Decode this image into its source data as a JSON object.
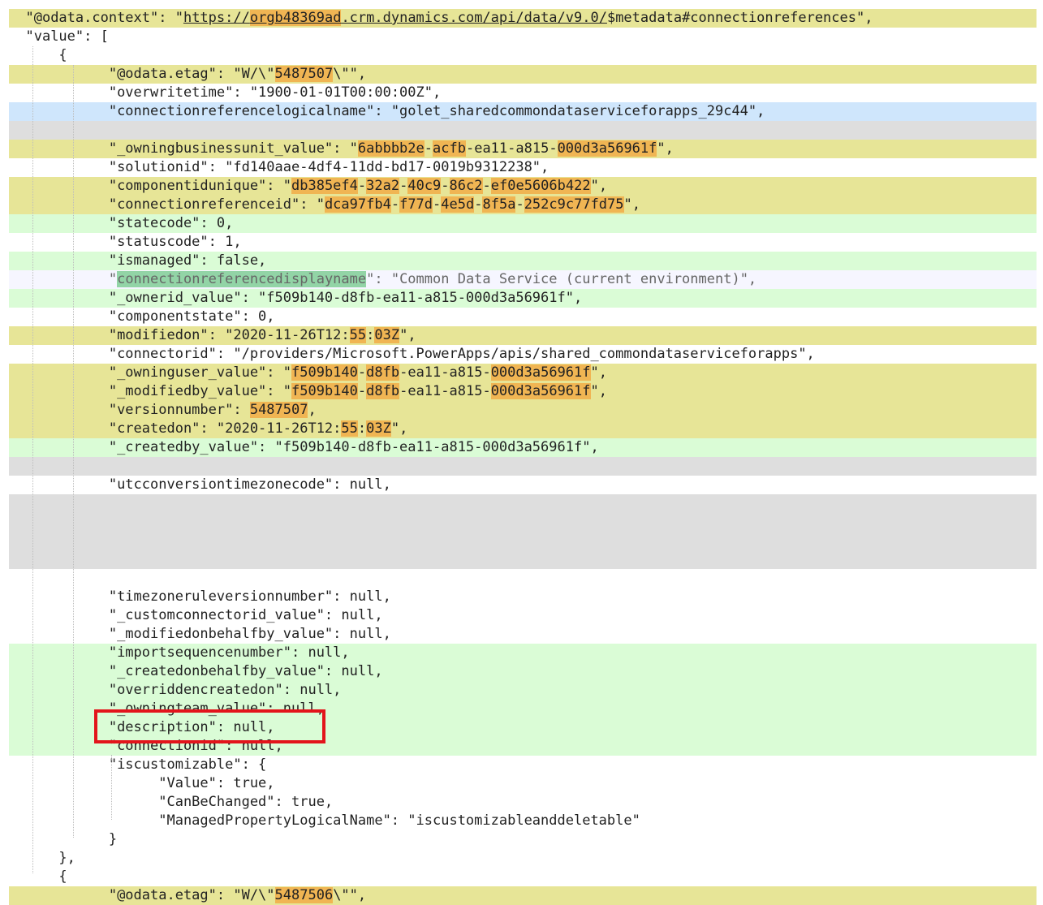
{
  "json_view": {
    "lines": [
      {
        "indent": "  ",
        "bg": "yellow",
        "segments": [
          {
            "t": "\"@odata.context\": \""
          },
          {
            "t": "https://",
            "c": "lnk"
          },
          {
            "t": "orgb48369ad",
            "c": "hl lnk"
          },
          {
            "t": ".crm.dynamics.com/api/data/v9.0/",
            "c": "lnk"
          },
          {
            "t": "$metadata#connectionreferences\","
          }
        ]
      },
      {
        "indent": "  ",
        "bg": "white",
        "segments": [
          {
            "t": "\"value\": ["
          }
        ]
      },
      {
        "indent": "      ",
        "bg": "white",
        "segments": [
          {
            "t": "{"
          }
        ]
      },
      {
        "indent": "            ",
        "bg": "yellow",
        "segments": [
          {
            "t": "\"@odata.etag\": \"W/\\\""
          },
          {
            "t": "5487507",
            "c": "hl"
          },
          {
            "t": "\\\"\","
          }
        ]
      },
      {
        "indent": "            ",
        "bg": "white",
        "segments": [
          {
            "t": "\"overwritetime\": \"1900-01-01T00:00:00Z\","
          }
        ]
      },
      {
        "indent": "            ",
        "bg": "blue",
        "segments": [
          {
            "t": "\"connectionreferencelogicalname\": \"golet_sharedcommondataserviceforapps_29c44\","
          }
        ]
      },
      {
        "indent": "",
        "bg": "gray",
        "segments": [
          {
            "t": ""
          }
        ]
      },
      {
        "indent": "            ",
        "bg": "yellow",
        "segments": [
          {
            "t": "\"_owningbusinessunit_value\": \""
          },
          {
            "t": "6abbbb2e",
            "c": "hl"
          },
          {
            "t": "-"
          },
          {
            "t": "acfb",
            "c": "hl"
          },
          {
            "t": "-ea11-a815-"
          },
          {
            "t": "000d3a56961f",
            "c": "hl"
          },
          {
            "t": "\","
          }
        ]
      },
      {
        "indent": "            ",
        "bg": "white",
        "segments": [
          {
            "t": "\"solutionid\": \"fd140aae-4df4-11dd-bd17-0019b9312238\","
          }
        ]
      },
      {
        "indent": "            ",
        "bg": "yellow",
        "segments": [
          {
            "t": "\"componentidunique\": \""
          },
          {
            "t": "db385ef4",
            "c": "hl"
          },
          {
            "t": "-"
          },
          {
            "t": "32a2",
            "c": "hl"
          },
          {
            "t": "-"
          },
          {
            "t": "40c9",
            "c": "hl"
          },
          {
            "t": "-"
          },
          {
            "t": "86c2",
            "c": "hl"
          },
          {
            "t": "-"
          },
          {
            "t": "ef0e5606b422",
            "c": "hl"
          },
          {
            "t": "\","
          }
        ]
      },
      {
        "indent": "            ",
        "bg": "yellow",
        "segments": [
          {
            "t": "\"connectionreferenceid\": \""
          },
          {
            "t": "dca97fb4",
            "c": "hl"
          },
          {
            "t": "-"
          },
          {
            "t": "f77d",
            "c": "hl"
          },
          {
            "t": "-"
          },
          {
            "t": "4e5d",
            "c": "hl"
          },
          {
            "t": "-"
          },
          {
            "t": "8f5a",
            "c": "hl"
          },
          {
            "t": "-"
          },
          {
            "t": "252c9c77fd75",
            "c": "hl"
          },
          {
            "t": "\","
          }
        ]
      },
      {
        "indent": "            ",
        "bg": "green",
        "segments": [
          {
            "t": "\"statecode\": 0,"
          }
        ]
      },
      {
        "indent": "            ",
        "bg": "white",
        "segments": [
          {
            "t": "\"statuscode\": 1,"
          }
        ]
      },
      {
        "indent": "            ",
        "bg": "green",
        "segments": [
          {
            "t": "\"ismanaged\": false,"
          }
        ]
      },
      {
        "indent": "            ",
        "bg": "lav",
        "segments": [
          {
            "t": "\"",
            "c": "gray-text"
          },
          {
            "t": "connectionreferencedisplayname",
            "c": "sel gray-text"
          },
          {
            "t": "\": \"Common Data Service (current environment)\",",
            "c": "gray-text"
          }
        ]
      },
      {
        "indent": "            ",
        "bg": "green",
        "segments": [
          {
            "t": "\"_ownerid_value\": \"f509b140-d8fb-ea11-a815-000d3a56961f\","
          }
        ]
      },
      {
        "indent": "            ",
        "bg": "white",
        "segments": [
          {
            "t": "\"componentstate\": 0,"
          }
        ]
      },
      {
        "indent": "            ",
        "bg": "yellow",
        "segments": [
          {
            "t": "\"modifiedon\": \"2020-11-26T12:"
          },
          {
            "t": "55",
            "c": "hl"
          },
          {
            "t": ":"
          },
          {
            "t": "03Z",
            "c": "hl"
          },
          {
            "t": "\","
          }
        ]
      },
      {
        "indent": "            ",
        "bg": "white",
        "segments": [
          {
            "t": "\"connectorid\": \"/providers/Microsoft.PowerApps/apis/shared_commondataserviceforapps\","
          }
        ]
      },
      {
        "indent": "            ",
        "bg": "yellow",
        "segments": [
          {
            "t": "\"_owninguser_value\": \""
          },
          {
            "t": "f509b140",
            "c": "hl"
          },
          {
            "t": "-"
          },
          {
            "t": "d8fb",
            "c": "hl"
          },
          {
            "t": "-ea11-a815-"
          },
          {
            "t": "000d3a56961f",
            "c": "hl"
          },
          {
            "t": "\","
          }
        ]
      },
      {
        "indent": "            ",
        "bg": "yellow",
        "segments": [
          {
            "t": "\"_modifiedby_value\": \""
          },
          {
            "t": "f509b140",
            "c": "hl"
          },
          {
            "t": "-"
          },
          {
            "t": "d8fb",
            "c": "hl"
          },
          {
            "t": "-ea11-a815-"
          },
          {
            "t": "000d3a56961f",
            "c": "hl"
          },
          {
            "t": "\","
          }
        ]
      },
      {
        "indent": "            ",
        "bg": "yellow",
        "segments": [
          {
            "t": "\"versionnumber\": "
          },
          {
            "t": "5487507",
            "c": "hl"
          },
          {
            "t": ","
          }
        ]
      },
      {
        "indent": "            ",
        "bg": "yellow",
        "segments": [
          {
            "t": "\"createdon\": \"2020-11-26T12:"
          },
          {
            "t": "55",
            "c": "hl"
          },
          {
            "t": ":"
          },
          {
            "t": "03Z",
            "c": "hl"
          },
          {
            "t": "\","
          }
        ]
      },
      {
        "indent": "            ",
        "bg": "green",
        "segments": [
          {
            "t": "\"_createdby_value\": \"f509b140-d8fb-ea11-a815-000d3a56961f\","
          }
        ]
      },
      {
        "indent": "",
        "bg": "gray",
        "segments": [
          {
            "t": ""
          }
        ]
      },
      {
        "indent": "            ",
        "bg": "white",
        "segments": [
          {
            "t": "\"utcconversiontimezonecode\": null,"
          }
        ]
      },
      {
        "indent": "",
        "bg": "gray",
        "segments": [
          {
            "t": ""
          }
        ]
      },
      {
        "indent": "",
        "bg": "gray",
        "segments": [
          {
            "t": ""
          }
        ]
      },
      {
        "indent": "",
        "bg": "gray",
        "segments": [
          {
            "t": ""
          }
        ]
      },
      {
        "indent": "",
        "bg": "gray",
        "segments": [
          {
            "t": ""
          }
        ]
      },
      {
        "indent": "",
        "bg": "white",
        "segments": [
          {
            "t": ""
          }
        ]
      },
      {
        "indent": "            ",
        "bg": "white",
        "segments": [
          {
            "t": "\"timezoneruleversionnumber\": null,"
          }
        ]
      },
      {
        "indent": "            ",
        "bg": "white",
        "segments": [
          {
            "t": "\"_customconnectorid_value\": null,"
          }
        ]
      },
      {
        "indent": "            ",
        "bg": "white",
        "segments": [
          {
            "t": "\"_modifiedonbehalfby_value\": null,"
          }
        ]
      },
      {
        "indent": "            ",
        "bg": "green",
        "segments": [
          {
            "t": "\"importsequencenumber\": null,"
          }
        ]
      },
      {
        "indent": "            ",
        "bg": "green",
        "segments": [
          {
            "t": "\"_createdonbehalfby_value\": null,"
          }
        ]
      },
      {
        "indent": "            ",
        "bg": "green",
        "segments": [
          {
            "t": "\"overriddencreatedon\": null,"
          }
        ]
      },
      {
        "indent": "            ",
        "bg": "green",
        "segments": [
          {
            "t": "\"_owningteam_value\": null,"
          }
        ]
      },
      {
        "indent": "            ",
        "bg": "green",
        "segments": [
          {
            "t": "\"description\": null,"
          }
        ]
      },
      {
        "indent": "            ",
        "bg": "green",
        "segments": [
          {
            "t": "\"connectionid\": null,"
          }
        ]
      },
      {
        "indent": "            ",
        "bg": "white",
        "segments": [
          {
            "t": "\"iscustomizable\": {"
          }
        ]
      },
      {
        "indent": "                  ",
        "bg": "white",
        "segments": [
          {
            "t": "\"Value\": true,"
          }
        ]
      },
      {
        "indent": "                  ",
        "bg": "white",
        "segments": [
          {
            "t": "\"CanBeChanged\": true,"
          }
        ]
      },
      {
        "indent": "                  ",
        "bg": "white",
        "segments": [
          {
            "t": "\"ManagedPropertyLogicalName\": \"iscustomizableanddeletable\""
          }
        ]
      },
      {
        "indent": "            ",
        "bg": "white",
        "segments": [
          {
            "t": "}"
          }
        ]
      },
      {
        "indent": "      ",
        "bg": "white",
        "segments": [
          {
            "t": "},"
          }
        ]
      },
      {
        "indent": "      ",
        "bg": "white",
        "segments": [
          {
            "t": "{"
          }
        ]
      },
      {
        "indent": "            ",
        "bg": "yellow",
        "segments": [
          {
            "t": "\"@odata.etag\": \"W/\\\""
          },
          {
            "t": "5487506",
            "c": "hl"
          },
          {
            "t": "\\\"\","
          }
        ]
      }
    ]
  }
}
